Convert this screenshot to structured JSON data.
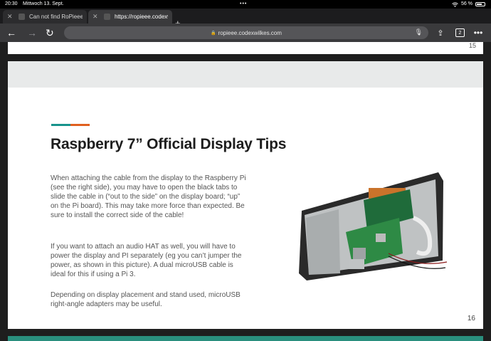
{
  "status": {
    "time": "20:30",
    "date": "Mittwoch 13. Sept.",
    "dots": "•••",
    "battery": "56 %"
  },
  "tabs": [
    {
      "title": "Can not find RoPieee XL"
    },
    {
      "title": "https://ropieee.codexwilk"
    }
  ],
  "toolbar": {
    "url": "ropieee.codexwilkes.com",
    "tab_count": "2"
  },
  "prev_slide": {
    "page_number": "15"
  },
  "slide": {
    "title": "Raspberry 7” Official Display Tips",
    "paragraphs": [
      "When attaching the cable from the display to the Raspberry Pi (see the right side), you may have to open the black tabs to slide the cable in (“out to the side” on the display board; “up” on the Pi board). This may take more force than expected. Be sure to install the correct side of the cable!",
      "If you want to attach an audio HAT as well, you will have to power the display and PI separately (eg you can’t jumper the power, as shown in this picture). A dual microUSB cable is ideal for this if using a Pi 3.",
      "Depending on display placement and stand used, microUSB right-angle adapters may be useful."
    ],
    "page_number": "16"
  },
  "colors": {
    "accent_teal": "#18938c",
    "accent_orange": "#e0601f",
    "toolbar": "#3a3a3c"
  },
  "icons": [
    "back-icon",
    "forward-icon",
    "reload-icon",
    "lock-icon",
    "mic-icon",
    "share-icon",
    "tabs-icon",
    "more-icon",
    "wifi-icon",
    "battery-icon",
    "close-icon",
    "plus-icon"
  ]
}
